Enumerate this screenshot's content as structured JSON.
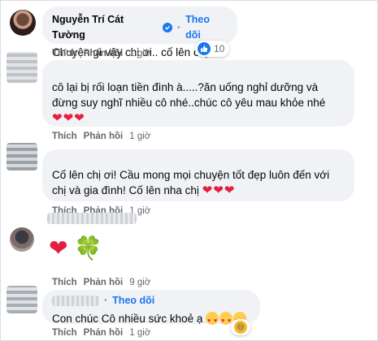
{
  "comments": [
    {
      "author": "Nguyễn Trí Cát Tường",
      "follow_label": "Theo dõi",
      "text": "Chuyện gì vậy chị ơi.. cố lên chị !",
      "reaction_count": "10",
      "actions": {
        "like": "Thích",
        "reply": "Phản hồi",
        "time": "1 giờ"
      }
    },
    {
      "text": "cô lại bị rối loạn tiền đình à.....?ăn uống nghỉ dưỡng và đừng suy nghĩ nhiều cô nhé..chúc cô yêu mau khỏe nhé",
      "hearts": "❤❤❤",
      "actions": {
        "like": "Thích",
        "reply": "Phản hồi",
        "time": "1 giờ"
      }
    },
    {
      "text": "Cố lên chị ơi! Cầu mong mọi chuyện tốt đẹp luôn đến với chị và gia đình! Cố lên nha chị",
      "hearts": "❤❤❤",
      "actions": {
        "like": "Thích",
        "reply": "Phản hồi",
        "time": "1 giờ"
      }
    },
    {
      "emoji": "❤ 🍀",
      "actions": {
        "like": "Thích",
        "reply": "Phản hồi",
        "time": "9 giờ"
      }
    },
    {
      "follow_label": "Theo dõi",
      "text": "Con chúc Cô nhiều sức khoẻ ạ",
      "actions": {
        "like": "Thích",
        "reply": "Phản hồi",
        "time": "1 giờ"
      }
    }
  ],
  "colors": {
    "accent": "#1877f2",
    "bubble": "#f0f2f5",
    "heart": "#e41e3f"
  }
}
